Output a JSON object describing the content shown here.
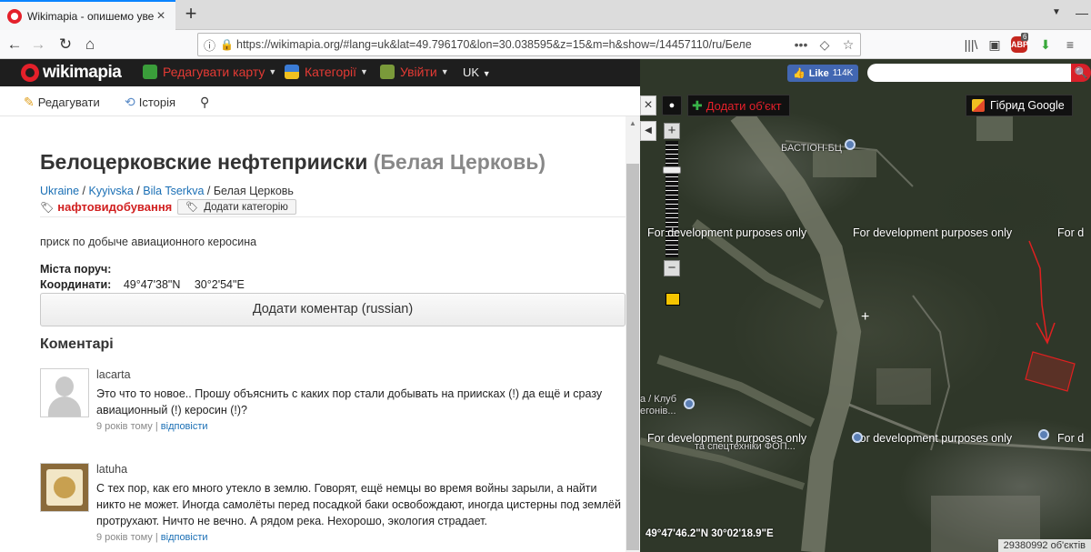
{
  "browser": {
    "tab_title": "Wikimapia - опишемо увесь с",
    "url": "https://wikimapia.org/#lang=uk&lat=49.796170&lon=30.038595&z=15&m=h&show=/14457110/ru/Беле",
    "abp_count": "6"
  },
  "header": {
    "logo_text": "wikimapia",
    "menu_edit_map": "Редагувати карту",
    "menu_categories": "Категорії",
    "menu_login": "Увійти",
    "menu_lang": "UK"
  },
  "panel_tools": {
    "edit": "Редагувати",
    "history": "Історія"
  },
  "place": {
    "title": "Белоцерковские нефтеприиски",
    "title_sub": "(Белая Церковь)",
    "breadcrumbs": [
      "Ukraine",
      "Kyyivska",
      "Bila Tserkva",
      "Белая Церковь"
    ],
    "tag": "нафтовидобування",
    "add_category": "Додати категорію",
    "description": "приcк по добыче авиационного керосина",
    "nearby_label": "Міста поруч:",
    "coords_label": "Координати:",
    "lat": "49°47'38\"N",
    "lon": "30°2'54\"E",
    "add_comment": "Додати коментар (russian)",
    "comments_header": "Коментарі"
  },
  "comments": [
    {
      "user": "lacarta",
      "text": "Это что то новое.. Прошу объяснить с каких пор стали добывать на приисках (!) да ещё и сразу авиационный (!) керосин (!)?",
      "age": "9 років тому",
      "reply": "відповісти"
    },
    {
      "user": "latuha",
      "text": "С тех пор, как его много утекло в землю. Говорят, ещё немцы во время войны зарыли, а найти никто не может. Иногда самолёты перед посадкой баки освобождают, иногда цистерны под землёй протрухают. Ничто не вечно. А рядом река. Нехорошо, экология страдает.",
      "age": "9 років тому",
      "reply": "відповісти"
    }
  ],
  "map": {
    "fb_like": "Like",
    "fb_count": "114K",
    "search_placeholder": "",
    "add_object": "Додати об'єкт",
    "map_type": "Гібрид Google",
    "dev_text": "For development purposes only",
    "dev_text_cut": "For d",
    "label_bastion": "БАСТІОН-БЦ",
    "label_club": "а / Клуб",
    "label_club2": "егонів...",
    "label_tech": "та спецтехніки ФОП...",
    "coord_readout": "49°47'46.2\"N 30°02'18.9\"E",
    "object_count": "29380992 об'єктів"
  },
  "colors": {
    "brand_red": "#e4202a",
    "link_blue": "#1a6fb5",
    "header_bg": "#1e1e1e"
  }
}
